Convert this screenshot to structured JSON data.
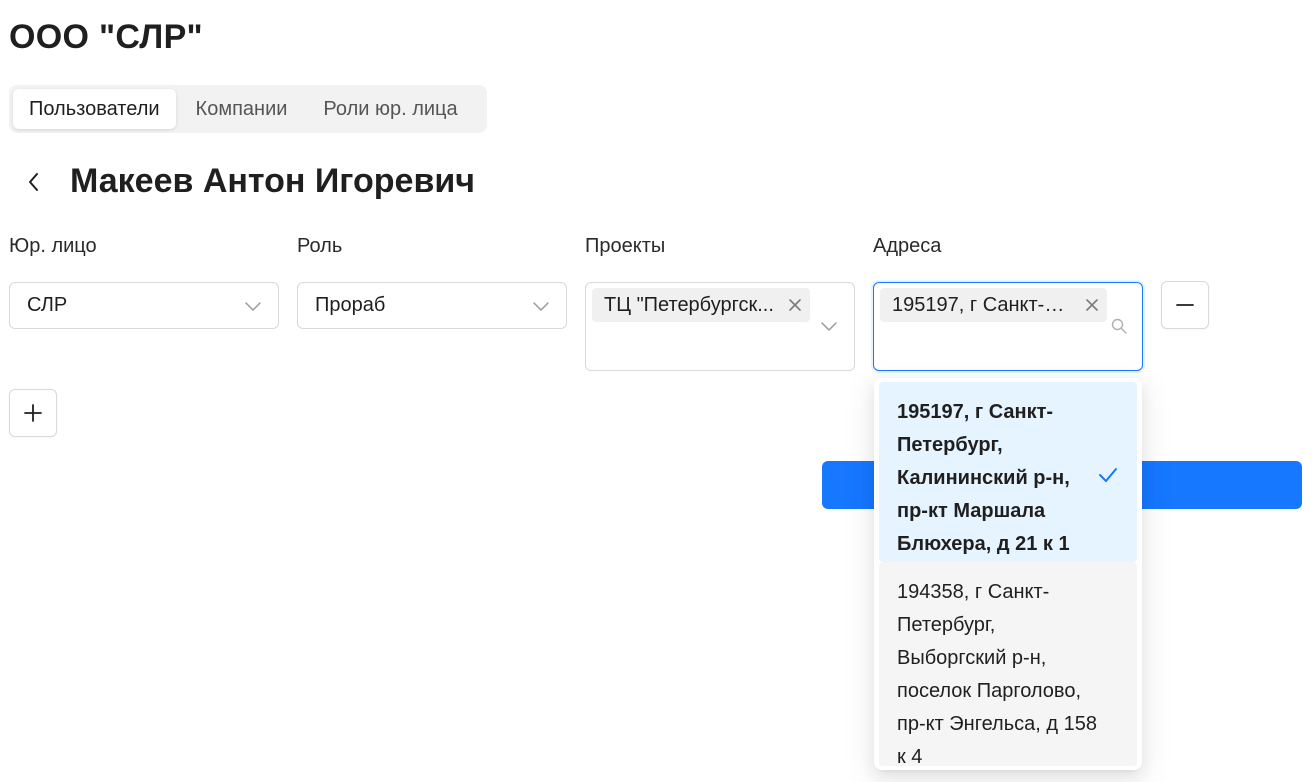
{
  "company": {
    "title": "ООО \"СЛР\""
  },
  "tabs": [
    {
      "label": "Пользователи",
      "active": true
    },
    {
      "label": "Компании",
      "active": false
    },
    {
      "label": "Роли юр. лица",
      "active": false
    }
  ],
  "page": {
    "title": "Макеев Антон Игоревич"
  },
  "form": {
    "legal_entity": {
      "label": "Юр. лицо",
      "value": "СЛР"
    },
    "role": {
      "label": "Роль",
      "value": "Прораб"
    },
    "projects": {
      "label": "Проекты",
      "tags": [
        "ТЦ \"Петербургск..."
      ]
    },
    "addresses": {
      "label": "Адреса",
      "tags": [
        "195197, г Санкт-П..."
      ]
    }
  },
  "address_dropdown": {
    "options": [
      {
        "text": "195197, г Санкт-Петербург, Калининский р-н, пр-кт Маршала Блюхера, д 21 к 1",
        "selected": true
      },
      {
        "text": "194358, г Санкт-Петербург, Выборгский р-н, поселок Парголово, пр-кт Энгельса, д 158 к 4",
        "selected": false
      }
    ]
  },
  "colors": {
    "primary": "#1677ff",
    "selected_option_bg": "#e6f4ff",
    "focus_border": "#1677ff"
  },
  "icons": {
    "back": "chevron-left-icon",
    "select_arrow": "chevron-down-icon",
    "search": "search-icon",
    "remove_tag": "close-icon",
    "remove_row": "minus-icon",
    "add_row": "plus-icon",
    "selected": "check-icon"
  }
}
